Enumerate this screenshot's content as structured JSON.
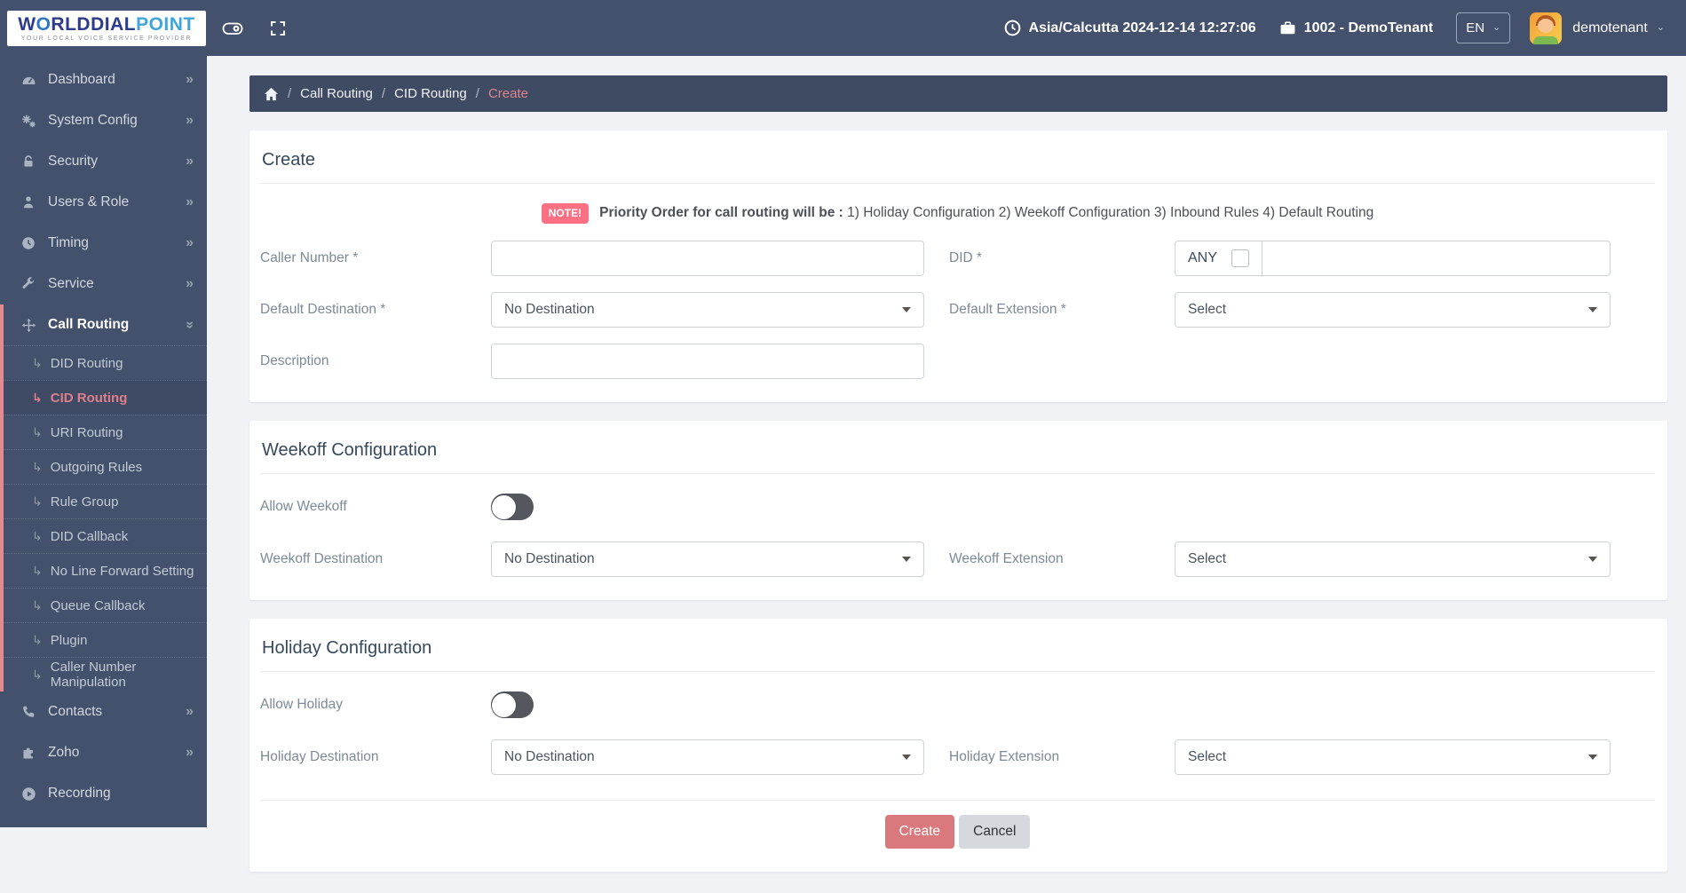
{
  "brand": {
    "logo_w": "W",
    "logo_o": "O",
    "logo_rest": "RLDDIAL",
    "logo_point": "POINT",
    "tagline": "YOUR LOCAL VOICE SERVICE PROVIDER"
  },
  "header": {
    "timezone": "Asia/Calcutta 2024-12-14 12:27:06",
    "tenant": "1002 - DemoTenant",
    "language": "EN",
    "username": "demotenant"
  },
  "glyphs": {
    "chevron": "»",
    "submenu_arrow": "↳",
    "caret": "⌄"
  },
  "sidebar": {
    "items": [
      {
        "label": "Dashboard",
        "icon": "dashboard-icon"
      },
      {
        "label": "System Config",
        "icon": "gears-icon"
      },
      {
        "label": "Security",
        "icon": "lock-icon"
      },
      {
        "label": "Users & Role",
        "icon": "user-icon"
      },
      {
        "label": "Timing",
        "icon": "clock-icon"
      },
      {
        "label": "Service",
        "icon": "wrench-icon"
      },
      {
        "label": "Call Routing",
        "icon": "move-icon",
        "expanded": true,
        "children": [
          {
            "label": "DID Routing"
          },
          {
            "label": "CID Routing",
            "active": true
          },
          {
            "label": "URI Routing"
          },
          {
            "label": "Outgoing Rules"
          },
          {
            "label": "Rule Group"
          },
          {
            "label": "DID Callback"
          },
          {
            "label": "No Line Forward Setting"
          },
          {
            "label": "Queue Callback"
          },
          {
            "label": "Plugin"
          },
          {
            "label": "Caller Number Manipulation"
          }
        ]
      },
      {
        "label": "Contacts",
        "icon": "phone-icon"
      },
      {
        "label": "Zoho",
        "icon": "puzzle-icon"
      },
      {
        "label": "Recording",
        "icon": "play-icon"
      }
    ]
  },
  "breadcrumb": {
    "separator": "/",
    "items": [
      "Call Routing",
      "CID Routing"
    ],
    "current": "Create"
  },
  "create_section": {
    "title": "Create",
    "note_badge": "NOTE!",
    "note_bold": "Priority Order for call routing will be :",
    "note_text": " 1) Holiday Configuration 2) Weekoff Configuration 3) Inbound Rules 4) Default Routing",
    "caller_number_label": "Caller Number *",
    "did_label": "DID *",
    "any_label": "ANY",
    "any_checked": false,
    "default_destination_label": "Default Destination *",
    "default_destination_value": "No Destination",
    "default_extension_label": "Default Extension *",
    "default_extension_value": "Select",
    "description_label": "Description"
  },
  "weekoff_section": {
    "title": "Weekoff Configuration",
    "allow_label": "Allow Weekoff",
    "allow_on": false,
    "destination_label": "Weekoff Destination",
    "destination_value": "No Destination",
    "extension_label": "Weekoff Extension",
    "extension_value": "Select"
  },
  "holiday_section": {
    "title": "Holiday Configuration",
    "allow_label": "Allow Holiday",
    "allow_on": false,
    "destination_label": "Holiday Destination",
    "destination_value": "No Destination",
    "extension_label": "Holiday Extension",
    "extension_value": "Select"
  },
  "actions": {
    "create": "Create",
    "cancel": "Cancel"
  },
  "colors": {
    "navy": "#44516c",
    "breadcrumb_navy": "#3e4b62",
    "accent_red": "#df7f8b",
    "note_badge_bg": "#fb7082",
    "create_button_bg": "#d9797d",
    "page_bg": "#f0f2f6"
  }
}
